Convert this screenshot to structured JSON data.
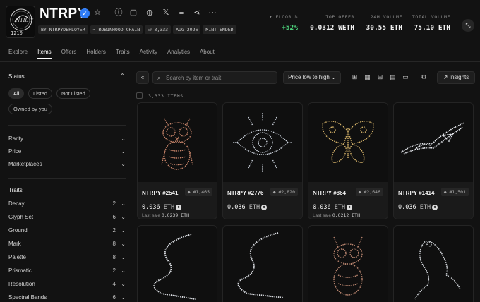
{
  "collection": {
    "name": "NTRPY",
    "logo_count": "1210",
    "tags": [
      "BY NTRPYDEPLOYER",
      "ROBINHOOD CHAIN",
      "3,333",
      "AUG 2026",
      "MINT ENDED"
    ]
  },
  "stats": [
    {
      "label": "FLOOR %",
      "value": "+52%"
    },
    {
      "label": "TOP OFFER",
      "value": "0.0312 WETH"
    },
    {
      "label": "24H VOLUME",
      "value": "30.55 ETH"
    },
    {
      "label": "TOTAL VOLUME",
      "value": "75.10 ETH"
    }
  ],
  "header_icons": [
    "star-icon",
    "info-icon",
    "globe-icon",
    "x-icon",
    "stack-icon",
    "share-icon",
    "more-icon"
  ],
  "tabs": [
    "Explore",
    "Items",
    "Offers",
    "Holders",
    "Traits",
    "Activity",
    "Analytics",
    "About"
  ],
  "active_tab": "Items",
  "sidebar": {
    "status_title": "Status",
    "status_options": [
      "All",
      "Listed",
      "Not Listed",
      "Owned by you"
    ],
    "selected_status": "All",
    "filters": [
      "Rarity",
      "Price",
      "Marketplaces"
    ],
    "traits_title": "Traits",
    "traits": [
      {
        "name": "Decay",
        "count": "2"
      },
      {
        "name": "Glyph Set",
        "count": "6"
      },
      {
        "name": "Ground",
        "count": "2"
      },
      {
        "name": "Mark",
        "count": "8"
      },
      {
        "name": "Palette",
        "count": "8"
      },
      {
        "name": "Prismatic",
        "count": "2"
      },
      {
        "name": "Resolution",
        "count": "4"
      },
      {
        "name": "Spectral Bands",
        "count": "6"
      }
    ]
  },
  "toolbar": {
    "search_placeholder": "Search by item or trait",
    "sort_label": "Price low to high",
    "insights_label": "Insights"
  },
  "items_count": "3,333 ITEMS",
  "items": [
    {
      "name": "NTRPY #2541",
      "rank": "#1,465",
      "price": "0.036",
      "unit": "ETH",
      "last_sale_label": "Last sale",
      "last_sale": "0.0239 ETH",
      "palette": "#c8856a"
    },
    {
      "name": "NTRPY #2776",
      "rank": "#2,820",
      "price": "0.036",
      "unit": "ETH",
      "last_sale_label": "",
      "last_sale": "",
      "palette": "#cfd6e0"
    },
    {
      "name": "NTRPY #864",
      "rank": "#2,646",
      "price": "0.036",
      "unit": "ETH",
      "last_sale_label": "Last sale",
      "last_sale": "0.0212 ETH",
      "palette": "#d8b56a"
    },
    {
      "name": "NTRPY #1414",
      "rank": "#1,501",
      "price": "0.036",
      "unit": "ETH",
      "last_sale_label": "",
      "last_sale": "",
      "palette": "#e6e9ee"
    }
  ],
  "colors": {
    "accent_green": "#4cd07a",
    "verified_blue": "#2f7cf6",
    "background": "#121212"
  }
}
